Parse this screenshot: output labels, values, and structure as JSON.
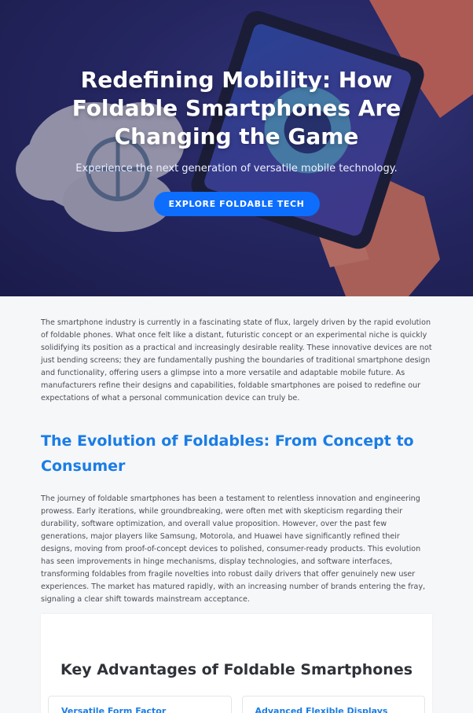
{
  "hero": {
    "title": "Redefining Mobility: How Foldable Smartphones Are Changing the Game",
    "subtitle": "Experience the next generation of versatile mobile technology.",
    "cta_label": "EXPLORE FOLDABLE TECH"
  },
  "intro": {
    "text": "The smartphone industry is currently in a fascinating state of flux, largely driven by the rapid evolution of foldable phones. What once felt like a distant, futuristic concept or an experimental niche is quickly solidifying its position as a practical and increasingly desirable reality. These innovative devices are not just bending screens; they are fundamentally pushing the boundaries of traditional smartphone design and functionality, offering users a glimpse into a more versatile and adaptable mobile future. As manufacturers refine their designs and capabilities, foldable smartphones are poised to redefine our expectations of what a personal communication device can truly be."
  },
  "evolution": {
    "title": "The Evolution of Foldables: From Concept to Consumer",
    "text": "The journey of foldable smartphones has been a testament to relentless innovation and engineering prowess. Early iterations, while groundbreaking, were often met with skepticism regarding their durability, software optimization, and overall value proposition. However, over the past few generations, major players like Samsung, Motorola, and Huawei have significantly refined their designs, moving from proof-of-concept devices to polished, consumer-ready products. This evolution has seen improvements in hinge mechanisms, display technologies, and software interfaces, transforming foldables from fragile novelties into robust daily drivers that offer genuinely new user experiences. The market has matured rapidly, with an increasing number of brands entering the fray, signaling a clear shift towards mainstream acceptance."
  },
  "advantages": {
    "title": "Key Advantages of Foldable Smartphones",
    "items": [
      {
        "label": "Versatile Form Factor"
      },
      {
        "label": "Advanced Flexible Displays"
      }
    ]
  },
  "colors": {
    "accent": "#1a7de6",
    "cta": "#0d6efd",
    "hero_bg": "#2a2c6d"
  }
}
